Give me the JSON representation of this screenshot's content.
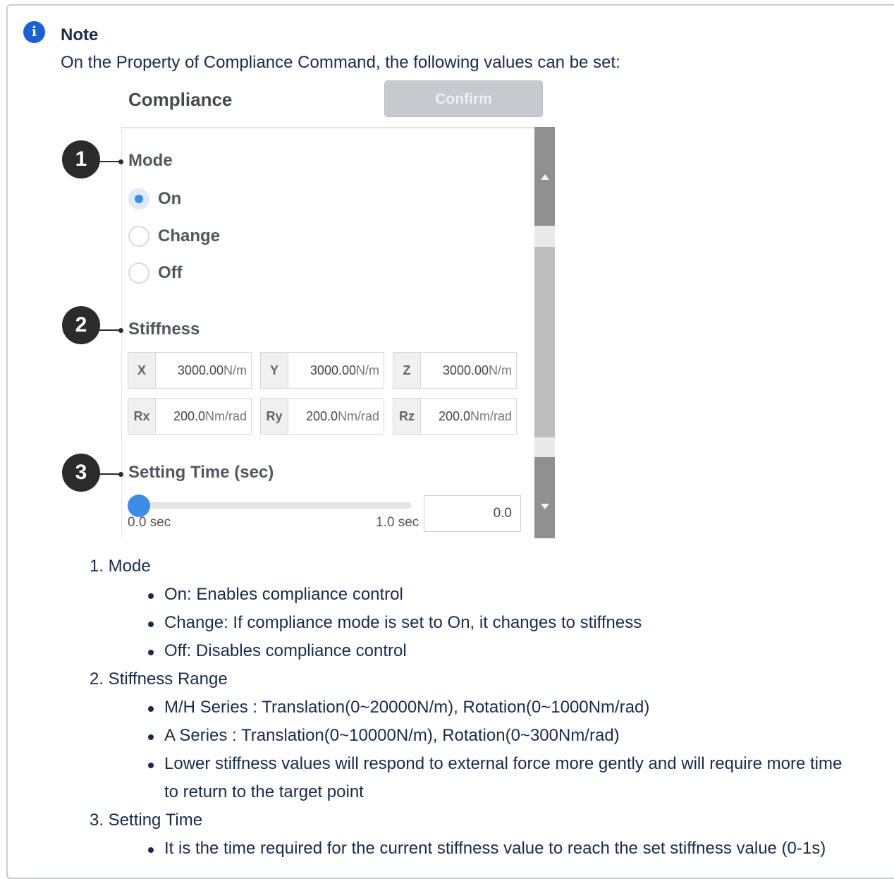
{
  "note": {
    "title": "Note",
    "intro": "On the Property of Compliance Command, the following values can be set:"
  },
  "panel": {
    "title": "Compliance",
    "confirm_label": "Confirm",
    "mode": {
      "label": "Mode",
      "options": [
        "On",
        "Change",
        "Off"
      ],
      "selected": "On"
    },
    "stiffness": {
      "label": "Stiffness",
      "fields": [
        {
          "axis": "X",
          "value": "3000.00",
          "unit": "N/m"
        },
        {
          "axis": "Y",
          "value": "3000.00",
          "unit": "N/m"
        },
        {
          "axis": "Z",
          "value": "3000.00",
          "unit": "N/m"
        },
        {
          "axis": "Rx",
          "value": "200.0",
          "unit": "Nm/rad"
        },
        {
          "axis": "Ry",
          "value": "200.0",
          "unit": "Nm/rad"
        },
        {
          "axis": "Rz",
          "value": "200.0",
          "unit": "Nm/rad"
        }
      ]
    },
    "setting_time": {
      "label": "Setting Time (sec)",
      "min_label": "0.0 sec",
      "max_label": "1.0 sec",
      "value": "0.0"
    },
    "callouts": [
      "1",
      "2",
      "3"
    ]
  },
  "list": {
    "items": [
      {
        "title": "1. Mode",
        "bullets": [
          "On: Enables compliance control",
          "Change: If compliance mode is set to On, it changes to stiffness",
          "Off: Disables compliance control"
        ]
      },
      {
        "title": "2. Stiffness Range",
        "bullets": [
          "M/H Series : Translation(0~20000N/m), Rotation(0~1000Nm/rad)",
          "A Series : Translation(0~10000N/m), Rotation(0~300Nm/rad)",
          "Lower stiffness values will respond to external force more gently and will require more time",
          "to return to the target point"
        ]
      },
      {
        "title": "3. Setting Time",
        "bullets": [
          "It is the time required for the current stiffness value to reach the set stiffness value (0-1s)"
        ]
      }
    ]
  },
  "colors": {
    "info_icon": "#1a5fd6",
    "radio_selected": "#3d8de8",
    "confirm_disabled": "#c6c9cd",
    "callout": "#2b2b2b"
  }
}
